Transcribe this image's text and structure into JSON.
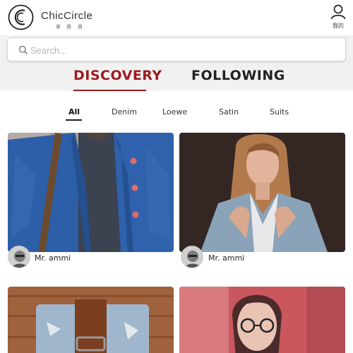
{
  "header": {
    "logo_text": "ChicCircle",
    "logo_subtext": "潮 圈 圈",
    "profile_label": "我的"
  },
  "search": {
    "placeholder": "Search...",
    "value": ""
  },
  "main_tabs": [
    {
      "label": "DISCOVERY",
      "active": true
    },
    {
      "label": "FOLLOWING",
      "active": false
    }
  ],
  "categories": [
    {
      "label": "All",
      "active": true
    },
    {
      "label": "Denim",
      "active": false
    },
    {
      "label": "Loewe",
      "active": false
    },
    {
      "label": "Satin",
      "active": false
    },
    {
      "label": "Suits",
      "active": false
    }
  ],
  "posts": [
    {
      "author": "Mr. ammi",
      "image": "denim-jacket-torso-photo"
    },
    {
      "author": "Mr. ammi",
      "image": "woman-denim-jacket-photo"
    },
    {
      "author": "",
      "image": "denim-jeans-leather-belt-photo"
    },
    {
      "author": "",
      "image": "woman-glasses-photo"
    }
  ],
  "colors": {
    "accent": "#9e1b1f",
    "band_background": "#f1f1f1"
  },
  "icons": {
    "logo": "chiccircle-logo-icon",
    "profile": "user-icon",
    "search": "search-icon",
    "avatar": "avatar-icon"
  }
}
